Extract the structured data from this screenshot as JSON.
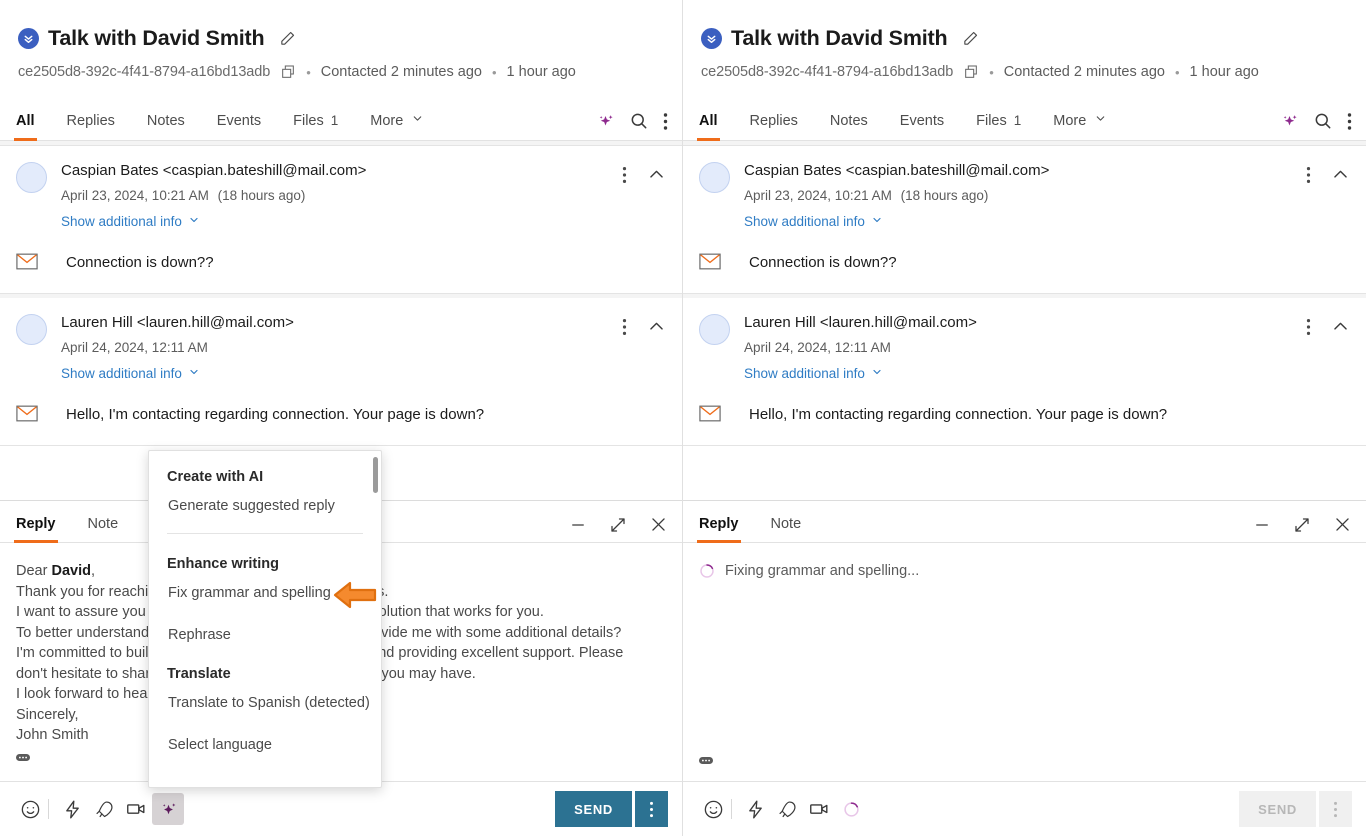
{
  "conversation": {
    "title": "Talk with David Smith",
    "source_icon": "double-chevron-down-icon",
    "edit_icon": "pencil-icon",
    "id": "ce2505d8-392c-4f41-8794-a16bd13adb",
    "copy_icon": "copy-icon",
    "contacted": "Contacted 2 minutes ago",
    "last_activity": "1 hour ago",
    "separator": "•"
  },
  "tabs": {
    "items": [
      {
        "label": "All",
        "badge": "",
        "active": true
      },
      {
        "label": "Replies",
        "badge": "",
        "active": false
      },
      {
        "label": "Notes",
        "badge": "",
        "active": false
      },
      {
        "label": "Events",
        "badge": "",
        "active": false
      },
      {
        "label": "Files",
        "badge": "1",
        "active": false
      },
      {
        "label": "More",
        "badge": "",
        "active": false
      }
    ],
    "actions": [
      {
        "name": "ai-sparkle-icon"
      },
      {
        "name": "search-icon"
      },
      {
        "name": "kebab-menu-icon"
      }
    ]
  },
  "messages": [
    {
      "from": "Caspian Bates <caspian.bateshill@mail.com>",
      "date": "April 23, 2024, 10:21 AM",
      "relative": "(18 hours ago)",
      "show_info": "Show additional info",
      "body": "Connection is down??"
    },
    {
      "from": "Lauren Hill <lauren.hill@mail.com>",
      "date": "April 24, 2024, 12:11 AM",
      "relative": "",
      "show_info": "Show additional info",
      "body": "Hello, I'm contacting regarding connection. Your page is down?"
    }
  ],
  "composer": {
    "tabs": [
      {
        "label": "Reply",
        "active": true
      },
      {
        "label": "Note",
        "active": false
      }
    ],
    "window_controls": [
      {
        "name": "minimize-icon"
      },
      {
        "name": "expand-icon"
      },
      {
        "name": "close-icon"
      }
    ],
    "draft_left": "Dear David,\nThank you for reaching out to us regarding your concerns.\nI want to assure you that we are committed to finding a solution that works for you.\nTo better understand your situation, could you please provide me with some additional details?\nI'm committed to building a strong partnership with you and providing excellent support. Please\ndon't hesitate to share any further concerns or questions you may have.\nI look forward to hearing from you soon.\nSincerely,\nJohn Smith",
    "draft_bold_word": "David",
    "loading_text": "Fixing grammar and spelling...",
    "loading_icon": "spinner-icon",
    "toolbar_icons": [
      {
        "name": "emoji-icon"
      },
      {
        "name": "lightning-icon"
      },
      {
        "name": "rocket-icon"
      },
      {
        "name": "video-camera-icon"
      },
      {
        "name": "ai-sparkle-icon"
      }
    ],
    "send_label": "SEND",
    "send_more_icon": "kebab-menu-icon",
    "attachment_indicator": "attachment-dots-icon"
  },
  "ai_menu": {
    "groups": [
      {
        "title": "Create with AI",
        "items": [
          "Generate suggested reply"
        ]
      },
      {
        "title": "Enhance writing",
        "items": [
          "Fix grammar and spelling",
          "Rephrase"
        ]
      },
      {
        "title": "Translate",
        "items": [
          "Translate to Spanish (detected)",
          "Select language"
        ]
      }
    ],
    "highlighted_item": "Fix grammar and spelling"
  },
  "annotation": {
    "pointer": "left-arrow-cursor",
    "color": "#f08020"
  },
  "colors": {
    "accent_orange": "#ef6c1a",
    "send_teal": "#2c7292",
    "link_blue": "#2f7cc4",
    "source_blue": "#3b5fc0",
    "ai_purple": "#8e2a8e",
    "arrow_orange": "#f08020"
  }
}
